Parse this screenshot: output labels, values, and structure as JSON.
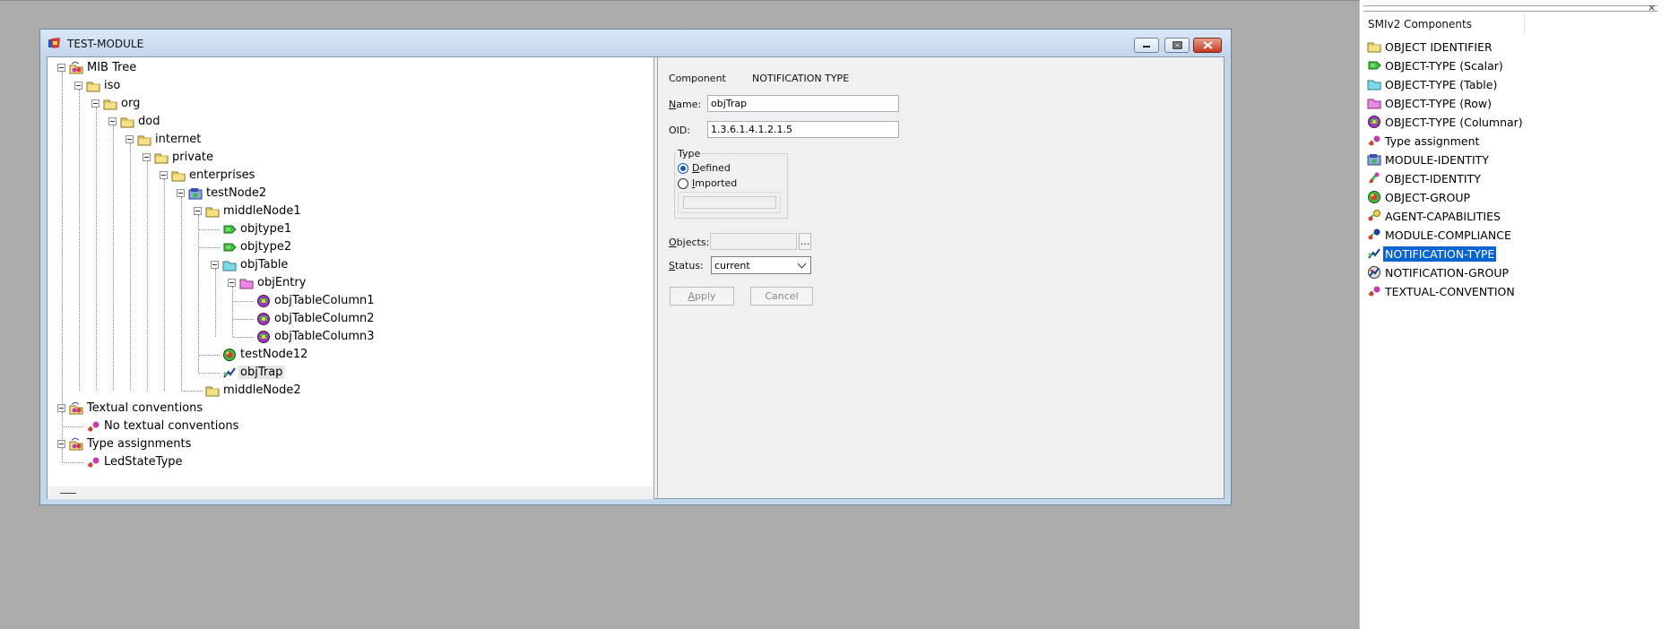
{
  "window": {
    "title": "TEST-MODULE",
    "minimize_icon": "minimize-icon",
    "maximize_icon": "restore-icon",
    "close_icon": "close-icon"
  },
  "tree": {
    "nodes": [
      {
        "label": "MIB Tree",
        "icon": "mib-root-icon"
      },
      {
        "label": "iso",
        "icon": "folder-icon"
      },
      {
        "label": "org",
        "icon": "folder-icon"
      },
      {
        "label": "dod",
        "icon": "folder-icon"
      },
      {
        "label": "internet",
        "icon": "folder-icon"
      },
      {
        "label": "private",
        "icon": "folder-icon"
      },
      {
        "label": "enterprises",
        "icon": "folder-icon"
      },
      {
        "label": "testNode2",
        "icon": "module-identity-icon"
      },
      {
        "label": "middleNode1",
        "icon": "folder-icon"
      },
      {
        "label": "objtype1",
        "icon": "scalar-icon"
      },
      {
        "label": "objtype2",
        "icon": "scalar-icon"
      },
      {
        "label": "objTable",
        "icon": "table-icon"
      },
      {
        "label": "objEntry",
        "icon": "row-icon"
      },
      {
        "label": "objTableColumn1",
        "icon": "columnar-icon"
      },
      {
        "label": "objTableColumn2",
        "icon": "columnar-icon"
      },
      {
        "label": "objTableColumn3",
        "icon": "columnar-icon"
      },
      {
        "label": "testNode12",
        "icon": "object-group-icon"
      },
      {
        "label": "objTrap",
        "icon": "notification-type-icon"
      },
      {
        "label": "middleNode2",
        "icon": "folder-icon"
      },
      {
        "label": "Textual conventions",
        "icon": "mib-root-icon"
      },
      {
        "label": "No textual conventions",
        "icon": "textual-convention-icon"
      },
      {
        "label": "Type assignments",
        "icon": "mib-root-icon"
      },
      {
        "label": "LedStateType",
        "icon": "type-assignment-icon"
      }
    ],
    "selected": "objTrap"
  },
  "props": {
    "component_label": "Component",
    "component_value": "NOTIFICATION TYPE",
    "name_label_u": "N",
    "name_label_rest": "ame:",
    "name_value": "objTrap",
    "oid_label": "OID:",
    "oid_value": "1.3.6.1.4.1.2.1.5",
    "type_group": "Type",
    "defined_u": "D",
    "defined_rest": "efined",
    "imported_u": "I",
    "imported_rest": "mported",
    "objects_u": "O",
    "objects_rest": "bjects:",
    "objects_value": "",
    "objects_btn": "...",
    "status_u": "S",
    "status_rest": "tatus:",
    "status_value": "current",
    "apply_u": "A",
    "apply_rest": "pply",
    "cancel_label": "Cancel",
    "type_selected": "Defined"
  },
  "palette": {
    "title": "SMIv2 Components",
    "close_glyph": "×",
    "items": [
      {
        "label": "OBJECT IDENTIFIER",
        "icon": "folder-icon"
      },
      {
        "label": "OBJECT-TYPE (Scalar)",
        "icon": "scalar-icon"
      },
      {
        "label": "OBJECT-TYPE (Table)",
        "icon": "table-icon"
      },
      {
        "label": "OBJECT-TYPE (Row)",
        "icon": "row-icon"
      },
      {
        "label": "OBJECT-TYPE (Columnar)",
        "icon": "columnar-icon"
      },
      {
        "label": "Type assignment",
        "icon": "type-assignment-icon"
      },
      {
        "label": "MODULE-IDENTITY",
        "icon": "module-identity-icon"
      },
      {
        "label": "OBJECT-IDENTITY",
        "icon": "object-identity-icon"
      },
      {
        "label": "OBJECT-GROUP",
        "icon": "object-group-icon"
      },
      {
        "label": "AGENT-CAPABILITIES",
        "icon": "agent-capabilities-icon"
      },
      {
        "label": "MODULE-COMPLIANCE",
        "icon": "module-compliance-icon"
      },
      {
        "label": "NOTIFICATION-TYPE",
        "icon": "notification-type-icon"
      },
      {
        "label": "NOTIFICATION-GROUP",
        "icon": "notification-group-icon"
      },
      {
        "label": "TEXTUAL-CONVENTION",
        "icon": "textual-convention-icon"
      }
    ],
    "selected": "NOTIFICATION-TYPE"
  },
  "colors": {
    "selection": "#0a64d2",
    "folder": "#f5e08a",
    "scalar": "#3cbf3c",
    "table": "#7fd8e6",
    "row": "#e88be0"
  }
}
